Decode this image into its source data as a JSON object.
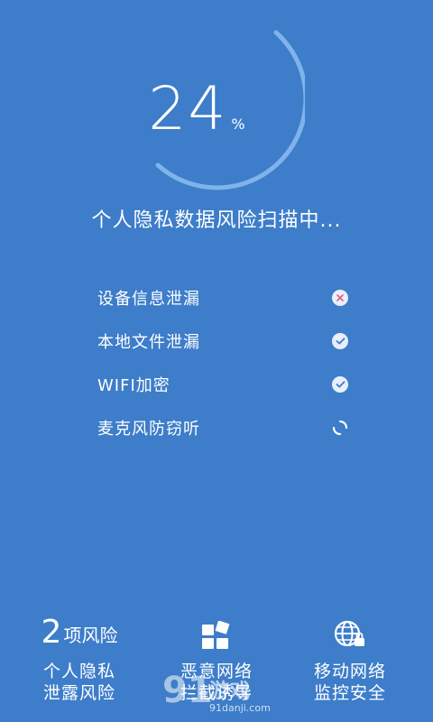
{
  "scan": {
    "progress_value": "24",
    "progress_unit": "%",
    "progress_fraction": 0.24,
    "status_text": "个人隐私数据风险扫描中..."
  },
  "checks": [
    {
      "label": "设备信息泄漏",
      "state": "failed",
      "icon": "x-circle-icon"
    },
    {
      "label": "本地文件泄漏",
      "state": "passed",
      "icon": "check-circle-icon"
    },
    {
      "label": "WIFI加密",
      "state": "passed",
      "icon": "check-circle-icon"
    },
    {
      "label": "麦克风防窃听",
      "state": "scanning",
      "icon": "spinner-icon"
    }
  ],
  "summary": {
    "risk_count": "2",
    "risk_count_suffix": "项风险",
    "privacy_line1": "个人隐私",
    "privacy_line2": "泄露风险",
    "malicious_line1": "恶意网络",
    "malicious_line2": "拦截诱导",
    "mobile_line1": "移动网络",
    "mobile_line2": "监控安全"
  },
  "watermark": {
    "logo": "91",
    "title": "游戏",
    "url": "91danji.com"
  },
  "colors": {
    "background": "#3d7dca",
    "ring": "#7fb3ea",
    "text": "#ffffff",
    "badge": "#e9eefb",
    "fail_mark": "#e2607d",
    "pass_mark": "#3d7dca"
  },
  "icons": {
    "malicious_network": "blocked-network-tiles-icon",
    "mobile_network": "globe-lock-icon"
  }
}
